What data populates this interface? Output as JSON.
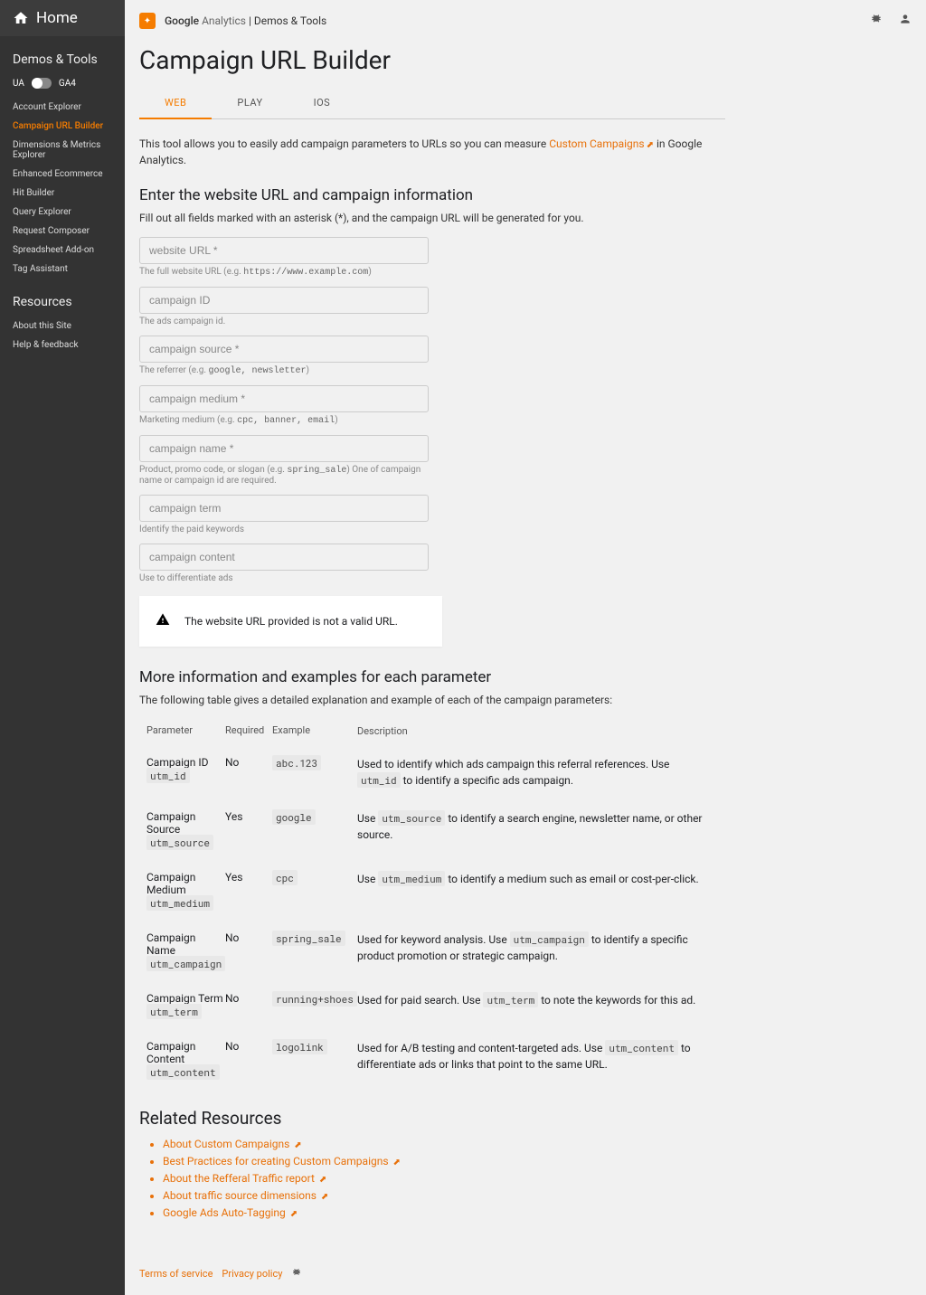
{
  "sidebar": {
    "home": "Home",
    "section1": "Demos & Tools",
    "toggle_left": "UA",
    "toggle_right": "GA4",
    "nav": [
      "Account Explorer",
      "Campaign URL Builder",
      "Dimensions & Metrics Explorer",
      "Enhanced Ecommerce",
      "Hit Builder",
      "Query Explorer",
      "Request Composer",
      "Spreadsheet Add-on",
      "Tag Assistant"
    ],
    "section2": "Resources",
    "nav2": [
      "About this Site",
      "Help & feedback"
    ]
  },
  "brand": {
    "g": "Google",
    "a": "Analytics",
    "sep": " | ",
    "dt": "Demos & Tools"
  },
  "title": "Campaign URL Builder",
  "tabs": [
    "WEB",
    "PLAY",
    "IOS"
  ],
  "intro1": "This tool allows you to easily add campaign parameters to URLs so you can measure ",
  "intro_link": "Custom Campaigns",
  "intro2": " in Google Analytics.",
  "h_enter": "Enter the website URL and campaign information",
  "sub_enter": "Fill out all fields marked with an asterisk (*), and the campaign URL will be generated for you.",
  "fields": [
    {
      "ph": "website URL *",
      "hint_pre": "The full website URL (e.g. ",
      "hint_code": "https://www.example.com",
      "hint_post": ")"
    },
    {
      "ph": "campaign ID",
      "hint_pre": "The ads campaign id.",
      "hint_code": "",
      "hint_post": ""
    },
    {
      "ph": "campaign source *",
      "hint_pre": "The referrer (e.g. ",
      "hint_code": "google, newsletter",
      "hint_post": ")"
    },
    {
      "ph": "campaign medium *",
      "hint_pre": "Marketing medium (e.g. ",
      "hint_code": "cpc, banner, email",
      "hint_post": ")"
    },
    {
      "ph": "campaign name *",
      "hint_pre": "Product, promo code, or slogan (e.g. ",
      "hint_code": "spring_sale",
      "hint_post": ") One of campaign name or campaign id are required."
    },
    {
      "ph": "campaign term",
      "hint_pre": "Identify the paid keywords",
      "hint_code": "",
      "hint_post": ""
    },
    {
      "ph": "campaign content",
      "hint_pre": "Use to differentiate ads",
      "hint_code": "",
      "hint_post": ""
    }
  ],
  "alert": "The website URL provided is not a valid URL.",
  "h_more": "More information and examples for each parameter",
  "sub_more": "The following table gives a detailed explanation and example of each of the campaign parameters:",
  "thead": {
    "p": "Parameter",
    "r": "Required",
    "e": "Example",
    "d": "Description"
  },
  "rows": [
    {
      "name": "Campaign ID",
      "code": "utm_id",
      "req": "No",
      "ex": "abc.123",
      "d1": "Used to identify which ads campaign this referral references. Use ",
      "dc": "utm_id",
      "d2": " to identify a specific ads campaign."
    },
    {
      "name": "Campaign Source",
      "code": "utm_source",
      "req": "Yes",
      "ex": "google",
      "d1": "Use ",
      "dc": "utm_source",
      "d2": " to identify a search engine, newsletter name, or other source."
    },
    {
      "name": "Campaign Medium",
      "code": "utm_medium",
      "req": "Yes",
      "ex": "cpc",
      "d1": "Use ",
      "dc": "utm_medium",
      "d2": " to identify a medium such as email or cost-per-click."
    },
    {
      "name": "Campaign Name",
      "code": "utm_campaign",
      "req": "No",
      "ex": "spring_sale",
      "d1": "Used for keyword analysis. Use ",
      "dc": "utm_campaign",
      "d2": " to identify a specific product promotion or strategic campaign."
    },
    {
      "name": "Campaign Term",
      "code": "utm_term",
      "req": "No",
      "ex": "running+shoes",
      "d1": "Used for paid search. Use ",
      "dc": "utm_term",
      "d2": " to note the keywords for this ad."
    },
    {
      "name": "Campaign Content",
      "code": "utm_content",
      "req": "No",
      "ex": "logolink",
      "d1": "Used for A/B testing and content-targeted ads. Use ",
      "dc": "utm_content",
      "d2": " to differentiate ads or links that point to the same URL."
    }
  ],
  "h_related": "Related Resources",
  "resources": [
    "About Custom Campaigns",
    "Best Practices for creating Custom Campaigns",
    "About the Refferal Traffic report",
    "About traffic source dimensions",
    "Google Ads Auto-Tagging"
  ],
  "footer": {
    "tos": "Terms of service",
    "pp": "Privacy policy"
  }
}
